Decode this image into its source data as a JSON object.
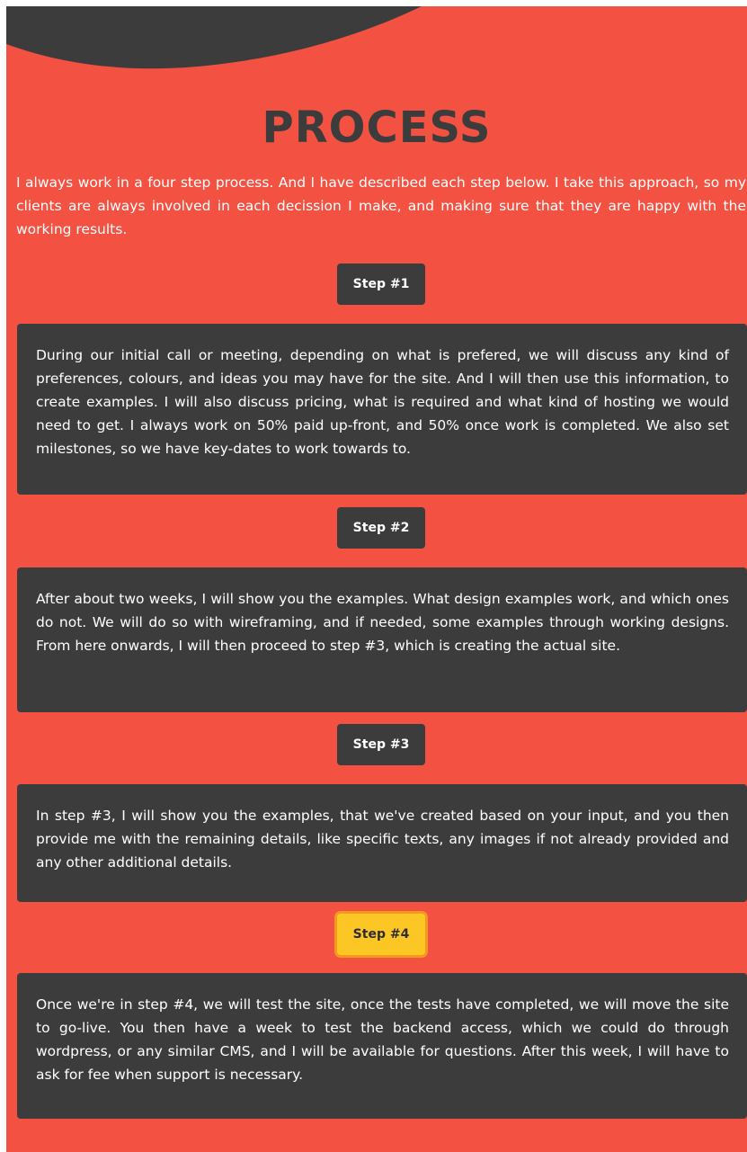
{
  "process": {
    "title": "PROCESS",
    "intro": "I always work in a four step process. And I have described each step below. I take this approach, so my clients are always involved in each decission I make, and making sure that they are happy with the working results.",
    "steps": [
      {
        "label": "Step #1",
        "text": "During our initial call or meeting, depending on what is prefered, we will discuss any kind of preferences, colours, and ideas you may have for the site. And I will then use this information, to create examples. I will also discuss pricing, what is required and what kind of hosting we would need to get. I always work on 50% paid up-front, and 50% once work is completed. We also set milestones, so we have key-dates to work towards to."
      },
      {
        "label": "Step #2",
        "text": "After about two weeks, I will show you the examples. What design examples work, and which ones do not. We will do so with wireframing, and if needed, some examples through working designs. From here onwards, I will then proceed to step #3, which is creating the actual site."
      },
      {
        "label": "Step #3",
        "text": "In step #3, I will show you the examples, that we've created based on your input, and you then provide me with the remaining details, like specific texts, any images if not already provided and any other additional details."
      },
      {
        "label": "Step #4",
        "text": "Once we're in step #4, we will test the site, once the tests have completed, we will move the site to go-live. You then have a week to test the backend access, which we could do through wordpress, or any similar CMS, and I will be available for questions. After this week, I will have to ask for fee when support is necessary."
      }
    ]
  },
  "colors": {
    "background": "#f35242",
    "dark": "#3c3c3c",
    "active_step": "#fcc624",
    "active_step_border": "#f39a1e",
    "text_light": "#ffffff"
  }
}
